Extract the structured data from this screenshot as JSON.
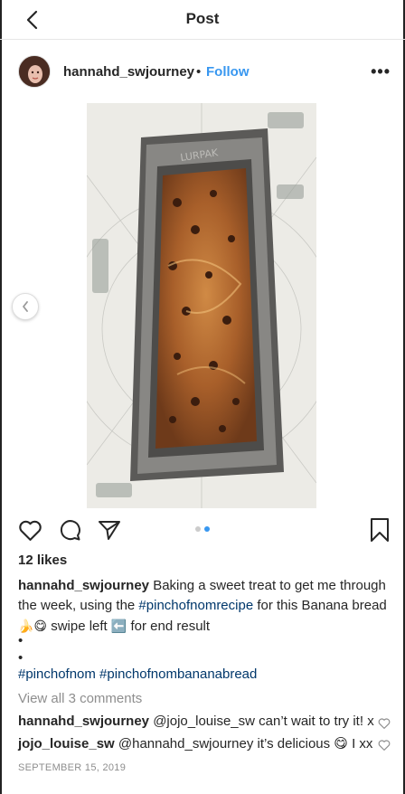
{
  "header_bar": {
    "title": "Post"
  },
  "post": {
    "username": "hannahd_swjourney",
    "separator": "•",
    "follow_label": "Follow",
    "more_label": "•••",
    "image": {
      "carousel_count": 2,
      "active_index": 1,
      "caption_on_tin": "LURPAK"
    },
    "likes": "12 likes",
    "caption": {
      "user": "hannahd_swjourney",
      "text_before": "Baking a sweet treat to get me through the week, using the ",
      "hashtag": "#pinchofnomrecipe",
      "text_after": " for this Banana bread ",
      "emojis": "🍌😋",
      "text_swipe": " swipe left ",
      "arrow_emoji": "⬅️",
      "text_end": " for end result"
    },
    "bullets": [
      "•",
      "•"
    ],
    "hashtags": "#pinchofnom #pinchofnombananabread",
    "view_all_comments": "View all 3 comments",
    "comments": [
      {
        "user": "hannahd_swjourney",
        "text": " @jojo_louise_sw can’t wait to try it! x"
      },
      {
        "user": "jojo_louise_sw",
        "text": " @hannahd_swjourney it’s delicious 😋 I xx"
      }
    ],
    "date": "SEPTEMBER 15, 2019"
  },
  "colors": {
    "accent": "#3897f0",
    "hashtag": "#00376b",
    "muted": "#8e8e8e",
    "text": "#262626"
  },
  "icons": [
    "back-arrow-icon",
    "more-options-icon",
    "carousel-prev-icon",
    "heart-icon",
    "comment-icon",
    "share-icon",
    "bookmark-icon",
    "comment-heart-icon"
  ]
}
